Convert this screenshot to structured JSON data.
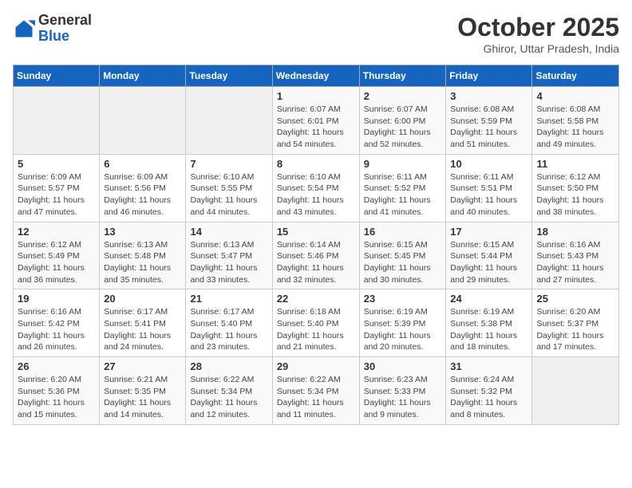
{
  "header": {
    "logo_general": "General",
    "logo_blue": "Blue",
    "month_title": "October 2025",
    "location": "Ghiror, Uttar Pradesh, India"
  },
  "days_of_week": [
    "Sunday",
    "Monday",
    "Tuesday",
    "Wednesday",
    "Thursday",
    "Friday",
    "Saturday"
  ],
  "weeks": [
    [
      {
        "num": "",
        "info": ""
      },
      {
        "num": "",
        "info": ""
      },
      {
        "num": "",
        "info": ""
      },
      {
        "num": "1",
        "info": "Sunrise: 6:07 AM\nSunset: 6:01 PM\nDaylight: 11 hours and 54 minutes."
      },
      {
        "num": "2",
        "info": "Sunrise: 6:07 AM\nSunset: 6:00 PM\nDaylight: 11 hours and 52 minutes."
      },
      {
        "num": "3",
        "info": "Sunrise: 6:08 AM\nSunset: 5:59 PM\nDaylight: 11 hours and 51 minutes."
      },
      {
        "num": "4",
        "info": "Sunrise: 6:08 AM\nSunset: 5:58 PM\nDaylight: 11 hours and 49 minutes."
      }
    ],
    [
      {
        "num": "5",
        "info": "Sunrise: 6:09 AM\nSunset: 5:57 PM\nDaylight: 11 hours and 47 minutes."
      },
      {
        "num": "6",
        "info": "Sunrise: 6:09 AM\nSunset: 5:56 PM\nDaylight: 11 hours and 46 minutes."
      },
      {
        "num": "7",
        "info": "Sunrise: 6:10 AM\nSunset: 5:55 PM\nDaylight: 11 hours and 44 minutes."
      },
      {
        "num": "8",
        "info": "Sunrise: 6:10 AM\nSunset: 5:54 PM\nDaylight: 11 hours and 43 minutes."
      },
      {
        "num": "9",
        "info": "Sunrise: 6:11 AM\nSunset: 5:52 PM\nDaylight: 11 hours and 41 minutes."
      },
      {
        "num": "10",
        "info": "Sunrise: 6:11 AM\nSunset: 5:51 PM\nDaylight: 11 hours and 40 minutes."
      },
      {
        "num": "11",
        "info": "Sunrise: 6:12 AM\nSunset: 5:50 PM\nDaylight: 11 hours and 38 minutes."
      }
    ],
    [
      {
        "num": "12",
        "info": "Sunrise: 6:12 AM\nSunset: 5:49 PM\nDaylight: 11 hours and 36 minutes."
      },
      {
        "num": "13",
        "info": "Sunrise: 6:13 AM\nSunset: 5:48 PM\nDaylight: 11 hours and 35 minutes."
      },
      {
        "num": "14",
        "info": "Sunrise: 6:13 AM\nSunset: 5:47 PM\nDaylight: 11 hours and 33 minutes."
      },
      {
        "num": "15",
        "info": "Sunrise: 6:14 AM\nSunset: 5:46 PM\nDaylight: 11 hours and 32 minutes."
      },
      {
        "num": "16",
        "info": "Sunrise: 6:15 AM\nSunset: 5:45 PM\nDaylight: 11 hours and 30 minutes."
      },
      {
        "num": "17",
        "info": "Sunrise: 6:15 AM\nSunset: 5:44 PM\nDaylight: 11 hours and 29 minutes."
      },
      {
        "num": "18",
        "info": "Sunrise: 6:16 AM\nSunset: 5:43 PM\nDaylight: 11 hours and 27 minutes."
      }
    ],
    [
      {
        "num": "19",
        "info": "Sunrise: 6:16 AM\nSunset: 5:42 PM\nDaylight: 11 hours and 26 minutes."
      },
      {
        "num": "20",
        "info": "Sunrise: 6:17 AM\nSunset: 5:41 PM\nDaylight: 11 hours and 24 minutes."
      },
      {
        "num": "21",
        "info": "Sunrise: 6:17 AM\nSunset: 5:40 PM\nDaylight: 11 hours and 23 minutes."
      },
      {
        "num": "22",
        "info": "Sunrise: 6:18 AM\nSunset: 5:40 PM\nDaylight: 11 hours and 21 minutes."
      },
      {
        "num": "23",
        "info": "Sunrise: 6:19 AM\nSunset: 5:39 PM\nDaylight: 11 hours and 20 minutes."
      },
      {
        "num": "24",
        "info": "Sunrise: 6:19 AM\nSunset: 5:38 PM\nDaylight: 11 hours and 18 minutes."
      },
      {
        "num": "25",
        "info": "Sunrise: 6:20 AM\nSunset: 5:37 PM\nDaylight: 11 hours and 17 minutes."
      }
    ],
    [
      {
        "num": "26",
        "info": "Sunrise: 6:20 AM\nSunset: 5:36 PM\nDaylight: 11 hours and 15 minutes."
      },
      {
        "num": "27",
        "info": "Sunrise: 6:21 AM\nSunset: 5:35 PM\nDaylight: 11 hours and 14 minutes."
      },
      {
        "num": "28",
        "info": "Sunrise: 6:22 AM\nSunset: 5:34 PM\nDaylight: 11 hours and 12 minutes."
      },
      {
        "num": "29",
        "info": "Sunrise: 6:22 AM\nSunset: 5:34 PM\nDaylight: 11 hours and 11 minutes."
      },
      {
        "num": "30",
        "info": "Sunrise: 6:23 AM\nSunset: 5:33 PM\nDaylight: 11 hours and 9 minutes."
      },
      {
        "num": "31",
        "info": "Sunrise: 6:24 AM\nSunset: 5:32 PM\nDaylight: 11 hours and 8 minutes."
      },
      {
        "num": "",
        "info": ""
      }
    ]
  ]
}
